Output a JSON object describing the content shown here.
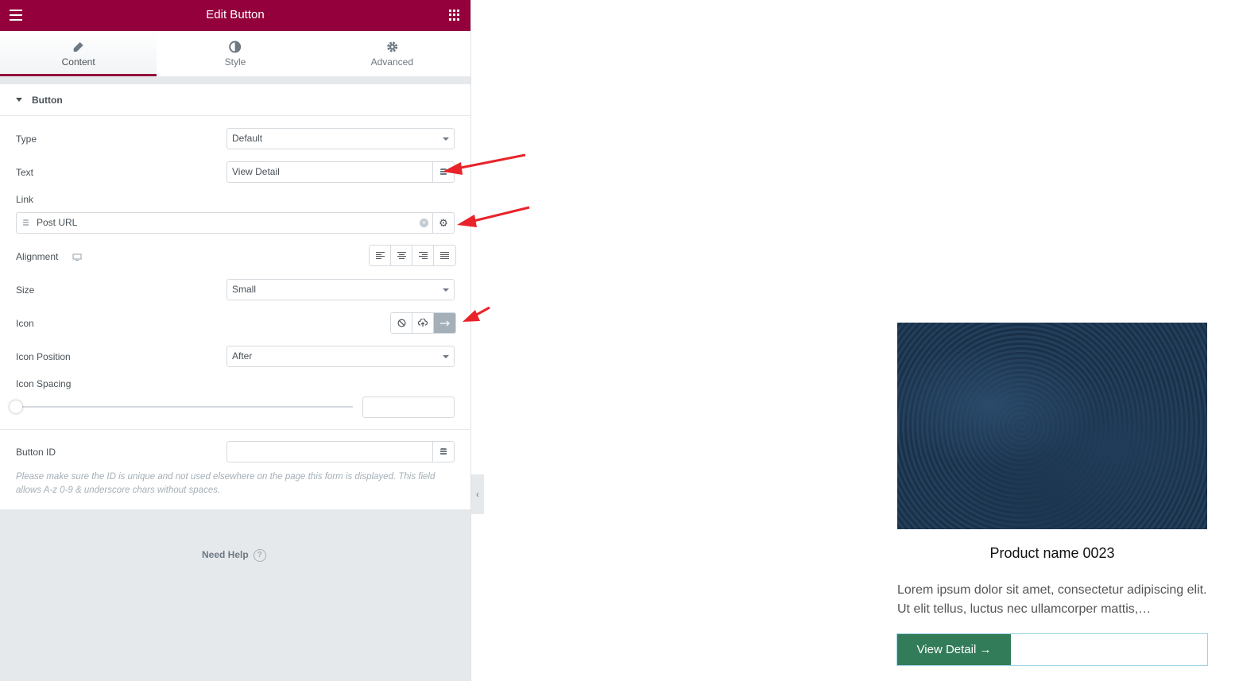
{
  "header": {
    "title": "Edit Button"
  },
  "tabs": [
    {
      "label": "Content",
      "icon": "pencil-icon"
    },
    {
      "label": "Style",
      "icon": "contrast-icon"
    },
    {
      "label": "Advanced",
      "icon": "gear-icon"
    }
  ],
  "section": {
    "title": "Button"
  },
  "fields": {
    "type": {
      "label": "Type",
      "value": "Default"
    },
    "text": {
      "label": "Text",
      "value": "View Detail"
    },
    "link": {
      "label": "Link",
      "value": "Post URL"
    },
    "alignment": {
      "label": "Alignment"
    },
    "size": {
      "label": "Size",
      "value": "Small"
    },
    "icon": {
      "label": "Icon"
    },
    "icon_position": {
      "label": "Icon Position",
      "value": "After"
    },
    "icon_spacing": {
      "label": "Icon Spacing"
    },
    "button_id": {
      "label": "Button ID"
    },
    "note_line1": "Please make sure the ID is unique and not used elsewhere on the page this form is displayed. This field",
    "note_line2": "allows A-z 0-9 & underscore chars without spaces."
  },
  "help": {
    "label": "Need Help",
    "icon": "?"
  },
  "preview": {
    "product_title": "Product name 0023",
    "description": "Lorem ipsum dolor sit amet, consectetur adipiscing elit. Ut elit tellus, luctus nec ullamcorper mattis,…",
    "button_label": "View Detail →"
  },
  "colors": {
    "brand": "#93003c",
    "button": "#337c5a",
    "annotation": "#e8232a"
  }
}
